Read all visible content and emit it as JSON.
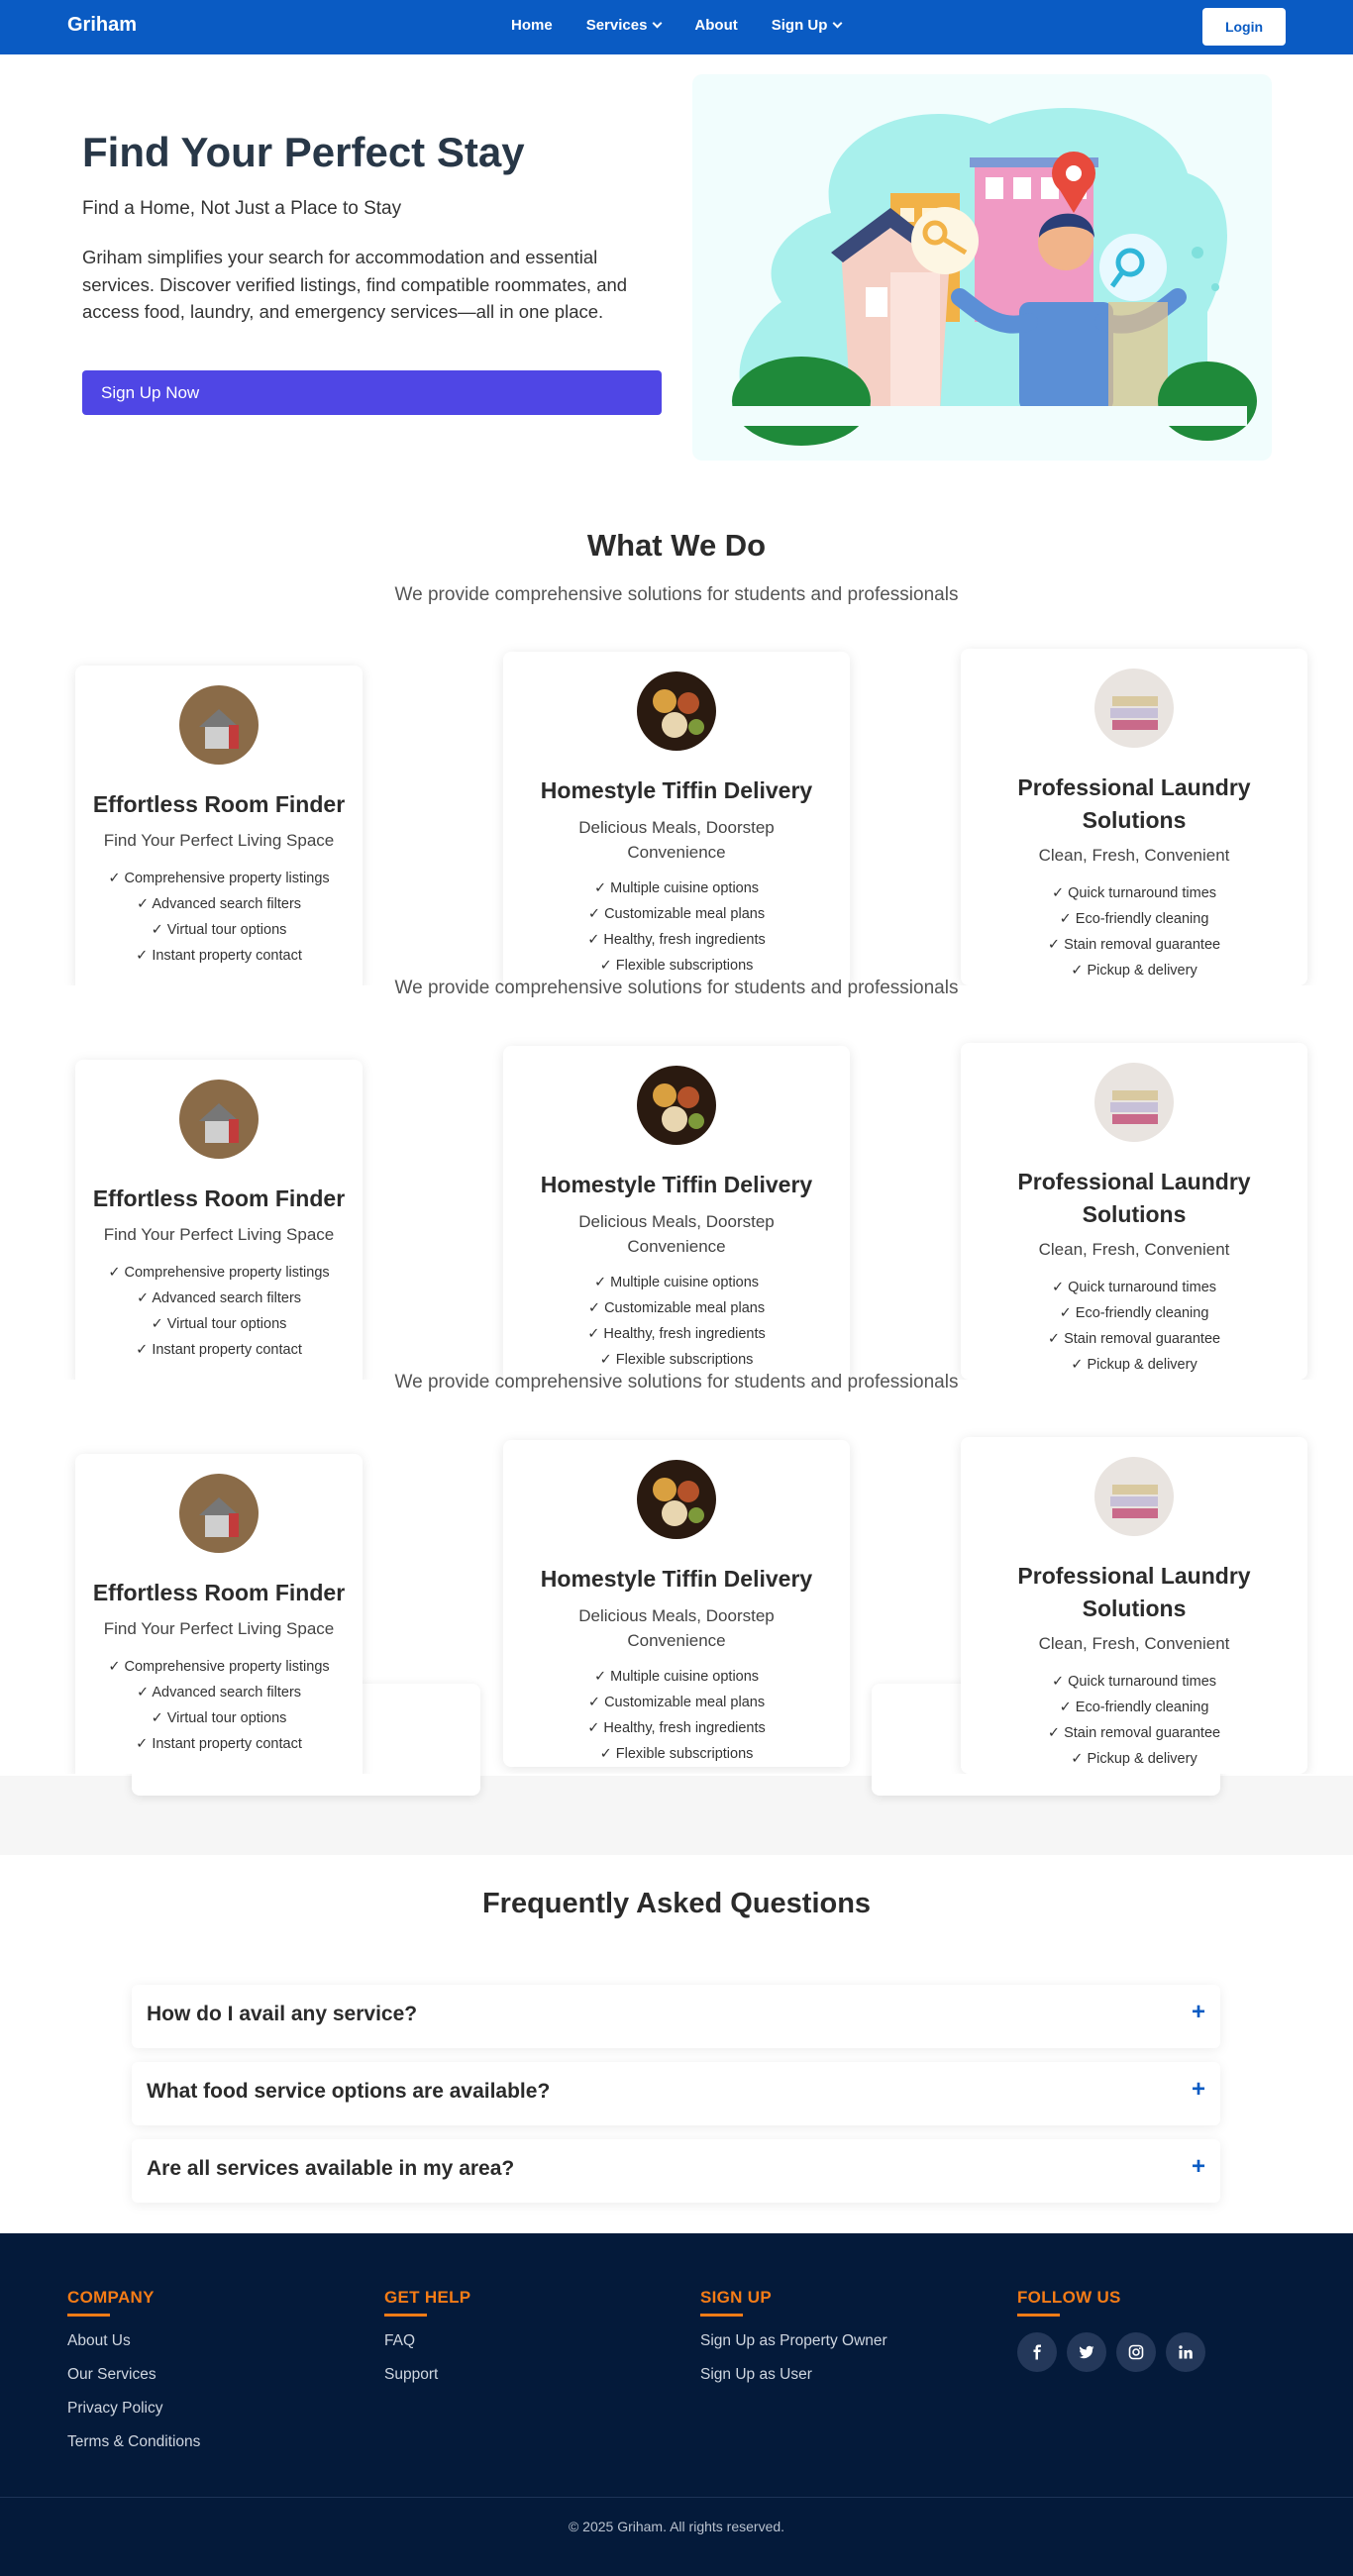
{
  "nav": {
    "brand": "Griham",
    "links": [
      {
        "label": "Home",
        "dropdown": false
      },
      {
        "label": "Services",
        "dropdown": true
      },
      {
        "label": "About",
        "dropdown": false
      },
      {
        "label": "Sign Up",
        "dropdown": true
      }
    ],
    "login": "Login"
  },
  "hero": {
    "title": "Find Your Perfect Stay",
    "subtitle": "Find a Home, Not Just a Place to Stay",
    "description": "Griham simplifies your search for accommodation and essential services. Discover verified listings, find compatible roommates, and access food, laundry, and emergency services—all in one place.",
    "cta": "Sign Up Now"
  },
  "services": {
    "title": "What We Do",
    "subtitle": "We provide comprehensive solutions for students and professionals",
    "repeated_subtitle": "We provide comprehensive solutions for students and professionals",
    "cards": [
      {
        "title": "Effortless Room Finder",
        "tagline": "Find Your Perfect Living Space",
        "features": [
          "✓ Comprehensive property listings",
          "✓ Advanced search filters",
          "✓ Virtual tour options",
          "✓ Instant property contact"
        ],
        "icon": "house-icon"
      },
      {
        "title": "Homestyle Tiffin Delivery",
        "tagline": "Delicious Meals, Doorstep Convenience",
        "features": [
          "✓ Multiple cuisine options",
          "✓ Customizable meal plans",
          "✓ Healthy, fresh ingredients",
          "✓ Flexible subscriptions"
        ],
        "icon": "food-icon"
      },
      {
        "title": "Professional Laundry Solutions",
        "tagline": "Clean, Fresh, Convenient",
        "features": [
          "✓ Quick turnaround times",
          "✓ Eco-friendly cleaning",
          "✓ Stain removal guarantee",
          "✓ Pickup & delivery"
        ],
        "icon": "laundry-icon"
      }
    ]
  },
  "faq": {
    "title": "Frequently Asked Questions",
    "items": [
      {
        "question": "How do I avail any service?",
        "toggle": "+"
      },
      {
        "question": "What food service options are available?",
        "toggle": "+"
      },
      {
        "question": "Are all services available in my area?",
        "toggle": "+"
      }
    ]
  },
  "footer": {
    "company": {
      "heading": "COMPANY",
      "links": [
        "About Us",
        "Our Services",
        "Privacy Policy",
        "Terms & Conditions"
      ]
    },
    "help": {
      "heading": "GET HELP",
      "links": [
        "FAQ",
        "Support"
      ]
    },
    "signup": {
      "heading": "SIGN UP",
      "links": [
        "Sign Up as Property Owner",
        "Sign Up as User"
      ]
    },
    "follow": {
      "heading": "FOLLOW US",
      "icons": [
        "facebook-icon",
        "twitter-icon",
        "instagram-icon",
        "linkedin-icon"
      ]
    },
    "copyright": "© 2025 Griham. All rights reserved."
  },
  "colors": {
    "primary": "#0a5bc3",
    "cta": "#4f46e5",
    "footer_bg": "#041a3a",
    "footer_accent": "#f57c16"
  }
}
